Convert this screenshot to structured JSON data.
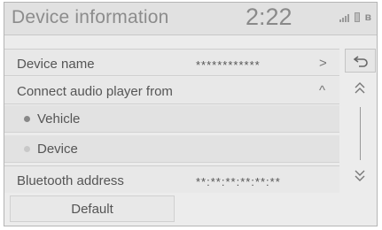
{
  "header": {
    "title": "Device information",
    "clock": "2:22"
  },
  "rows": {
    "device_name": {
      "label": "Device name",
      "value": "************",
      "chevron": ">"
    },
    "connect_audio": {
      "label": "Connect audio player from",
      "chevron": "^"
    },
    "bluetooth_address": {
      "label": "Bluetooth address",
      "value": "**:**:**:**:**:**"
    }
  },
  "audio_options": [
    {
      "label": "Vehicle",
      "selected": true
    },
    {
      "label": "Device",
      "selected": false
    }
  ],
  "footer": {
    "default_label": "Default"
  },
  "colors": {
    "radio_selected": "#888888",
    "radio_unselected": "#c8c8c8"
  }
}
